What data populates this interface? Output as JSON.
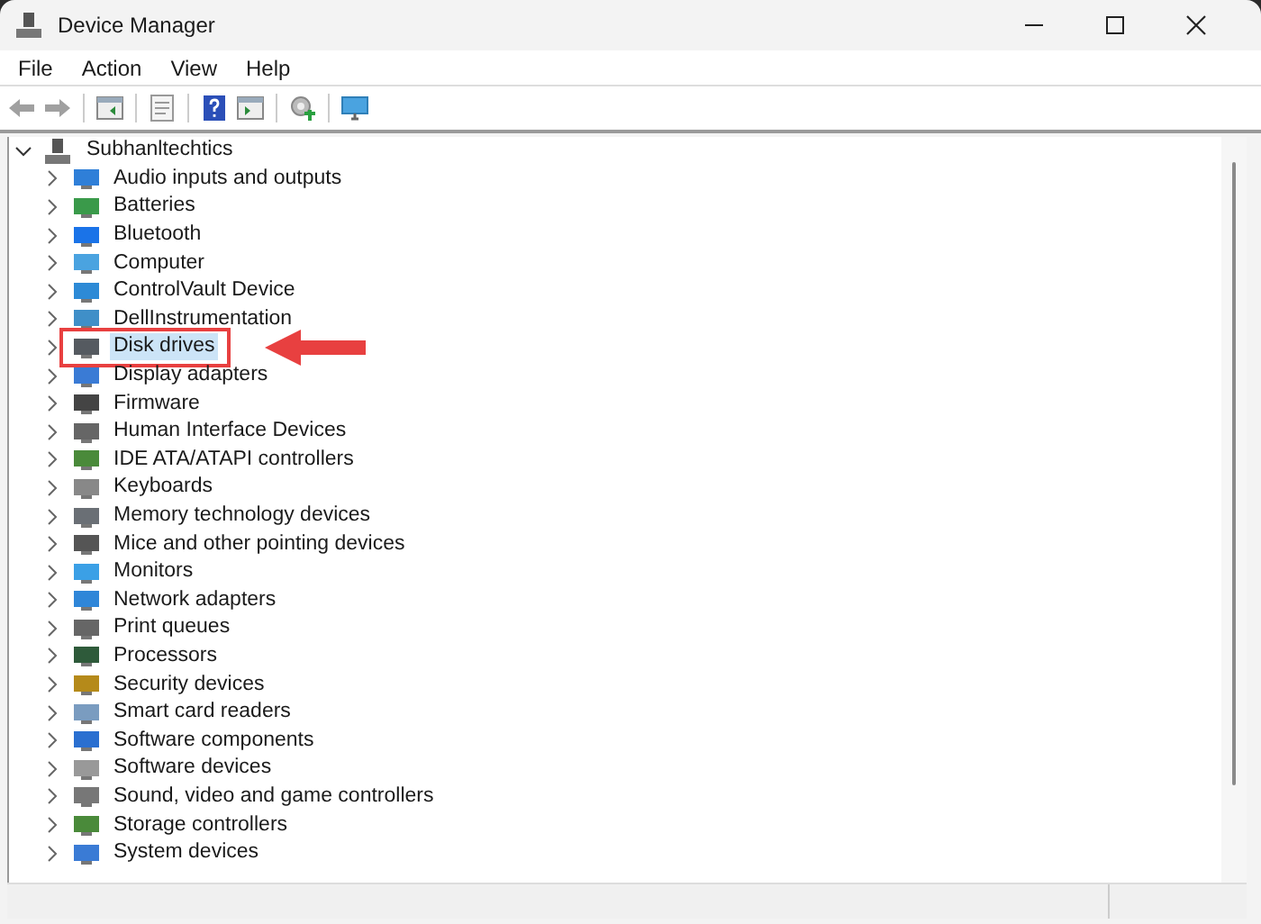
{
  "window": {
    "title": "Device Manager"
  },
  "menu": [
    "File",
    "Action",
    "View",
    "Help"
  ],
  "tree": {
    "label": "Subhanltechtics",
    "expanded": true,
    "children": [
      {
        "label": "Audio inputs and outputs",
        "selected": false,
        "highlighted": false
      },
      {
        "label": "Batteries",
        "selected": false,
        "highlighted": false
      },
      {
        "label": "Bluetooth",
        "selected": false,
        "highlighted": false
      },
      {
        "label": "Computer",
        "selected": false,
        "highlighted": false
      },
      {
        "label": "ControlVault Device",
        "selected": false,
        "highlighted": false
      },
      {
        "label": "DellInstrumentation",
        "selected": false,
        "highlighted": false
      },
      {
        "label": "Disk drives",
        "selected": true,
        "highlighted": true
      },
      {
        "label": "Display adapters",
        "selected": false,
        "highlighted": false
      },
      {
        "label": "Firmware",
        "selected": false,
        "highlighted": false
      },
      {
        "label": "Human Interface Devices",
        "selected": false,
        "highlighted": false
      },
      {
        "label": "IDE ATA/ATAPI controllers",
        "selected": false,
        "highlighted": false
      },
      {
        "label": "Keyboards",
        "selected": false,
        "highlighted": false
      },
      {
        "label": "Memory technology devices",
        "selected": false,
        "highlighted": false
      },
      {
        "label": "Mice and other pointing devices",
        "selected": false,
        "highlighted": false
      },
      {
        "label": "Monitors",
        "selected": false,
        "highlighted": false
      },
      {
        "label": "Network adapters",
        "selected": false,
        "highlighted": false
      },
      {
        "label": "Print queues",
        "selected": false,
        "highlighted": false
      },
      {
        "label": "Processors",
        "selected": false,
        "highlighted": false
      },
      {
        "label": "Security devices",
        "selected": false,
        "highlighted": false
      },
      {
        "label": "Smart card readers",
        "selected": false,
        "highlighted": false
      },
      {
        "label": "Software components",
        "selected": false,
        "highlighted": false
      },
      {
        "label": "Software devices",
        "selected": false,
        "highlighted": false
      },
      {
        "label": "Sound, video and game controllers",
        "selected": false,
        "highlighted": false
      },
      {
        "label": "Storage controllers",
        "selected": false,
        "highlighted": false
      },
      {
        "label": "System devices",
        "selected": false,
        "highlighted": false
      }
    ]
  }
}
